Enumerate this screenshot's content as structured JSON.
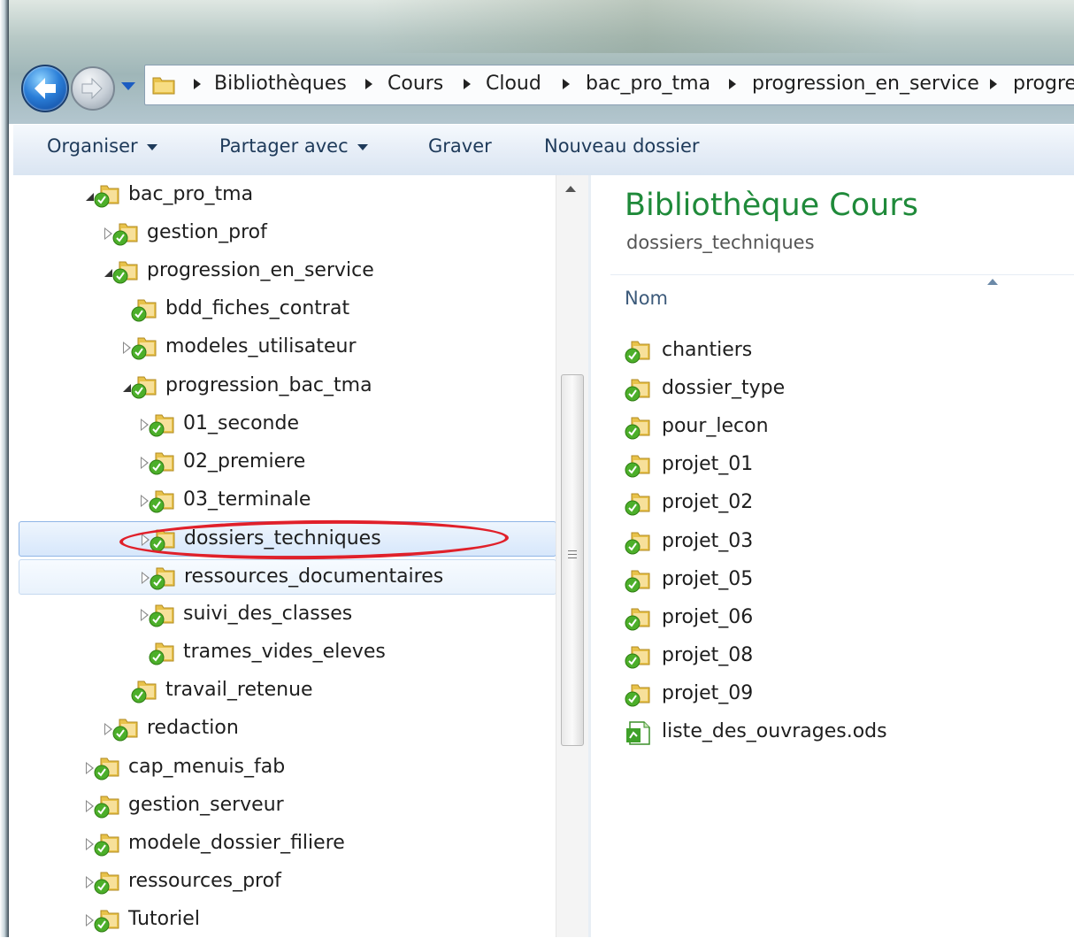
{
  "address": {
    "crumbs": [
      "Bibliothèques",
      "Cours",
      "Cloud",
      "bac_pro_tma",
      "progression_en_service",
      "progre"
    ]
  },
  "toolbar": {
    "organize": "Organiser",
    "share": "Partager avec",
    "burn": "Graver",
    "new_folder": "Nouveau dossier"
  },
  "nav_tree": [
    {
      "label": "bac_pro_tma",
      "level": 0,
      "state": "expanded"
    },
    {
      "label": "gestion_prof",
      "level": 1,
      "state": "collapsed"
    },
    {
      "label": "progression_en_service",
      "level": 1,
      "state": "expanded"
    },
    {
      "label": "bdd_fiches_contrat",
      "level": 2,
      "state": "none"
    },
    {
      "label": "modeles_utilisateur",
      "level": 2,
      "state": "collapsed"
    },
    {
      "label": "progression_bac_tma",
      "level": 2,
      "state": "expanded"
    },
    {
      "label": "01_seconde",
      "level": 3,
      "state": "collapsed"
    },
    {
      "label": "02_premiere",
      "level": 3,
      "state": "collapsed"
    },
    {
      "label": "03_terminale",
      "level": 3,
      "state": "collapsed"
    },
    {
      "label": "dossiers_techniques",
      "level": 3,
      "state": "collapsed",
      "selected": true
    },
    {
      "label": "ressources_documentaires",
      "level": 3,
      "state": "collapsed",
      "hover": true
    },
    {
      "label": "suivi_des_classes",
      "level": 3,
      "state": "collapsed"
    },
    {
      "label": "trames_vides_eleves",
      "level": 3,
      "state": "none"
    },
    {
      "label": "travail_retenue",
      "level": 2,
      "state": "none"
    },
    {
      "label": "redaction",
      "level": 1,
      "state": "collapsed"
    },
    {
      "label": "cap_menuis_fab",
      "level": 0,
      "state": "collapsed"
    },
    {
      "label": "gestion_serveur",
      "level": 0,
      "state": "collapsed"
    },
    {
      "label": "modele_dossier_filiere",
      "level": 0,
      "state": "collapsed"
    },
    {
      "label": "ressources_prof",
      "level": 0,
      "state": "collapsed"
    },
    {
      "label": "Tutoriel",
      "level": 0,
      "state": "collapsed"
    }
  ],
  "content": {
    "library_title": "Bibliothèque Cours",
    "subtitle": "dossiers_techniques",
    "column_name": "Nom",
    "items": [
      {
        "name": "chantiers",
        "type": "folder"
      },
      {
        "name": "dossier_type",
        "type": "folder"
      },
      {
        "name": "pour_lecon",
        "type": "folder"
      },
      {
        "name": "projet_01",
        "type": "folder"
      },
      {
        "name": "projet_02",
        "type": "folder"
      },
      {
        "name": "projet_03",
        "type": "folder"
      },
      {
        "name": "projet_05",
        "type": "folder"
      },
      {
        "name": "projet_06",
        "type": "folder"
      },
      {
        "name": "projet_08",
        "type": "folder"
      },
      {
        "name": "projet_09",
        "type": "folder"
      },
      {
        "name": "liste_des_ouvrages.ods",
        "type": "spreadsheet"
      }
    ]
  },
  "colors": {
    "library_title": "#1f8a3a",
    "annotation_oval": "#e0202a",
    "sync_badge": "#4caf2a",
    "folder": "#e8c24a"
  },
  "icons": {
    "back": "back-arrow-icon",
    "forward": "forward-arrow-icon",
    "folder": "synced-folder-icon",
    "spreadsheet": "spreadsheet-file-icon"
  }
}
